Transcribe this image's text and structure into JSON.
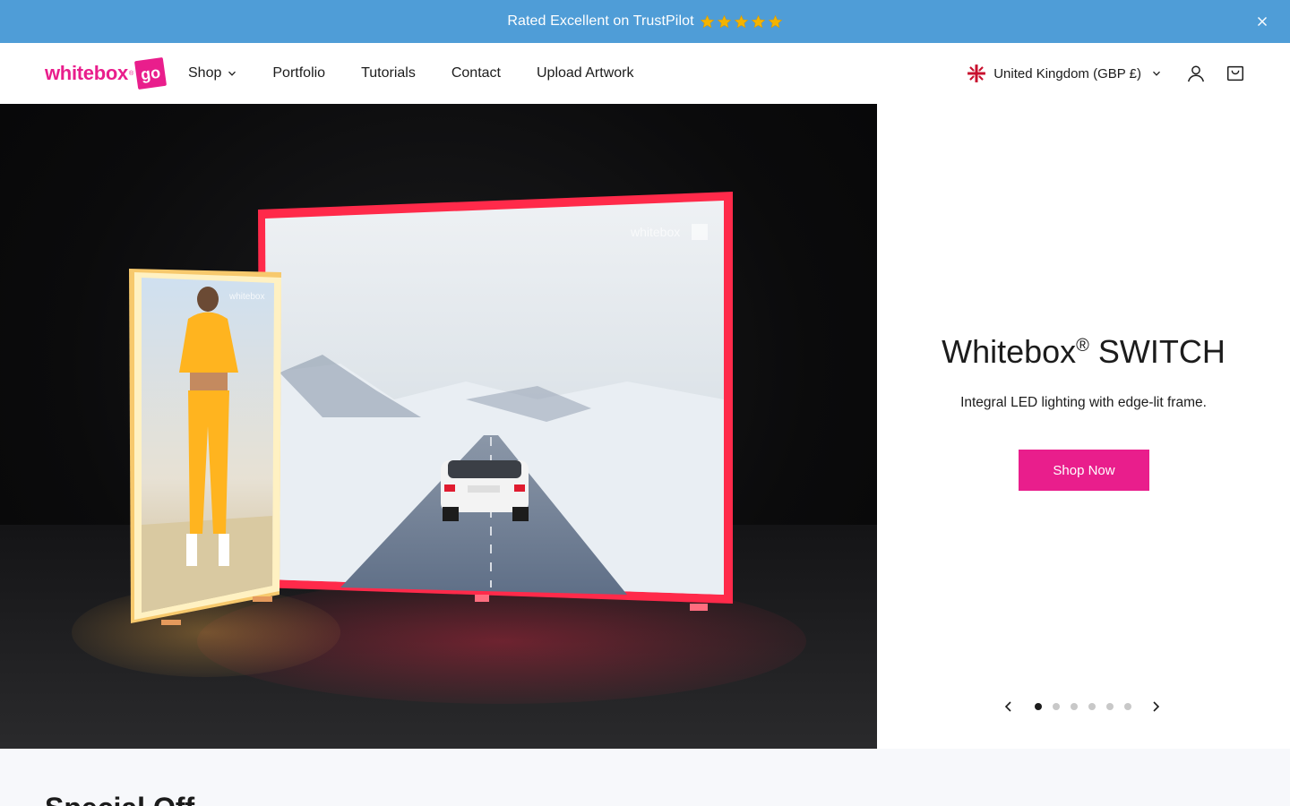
{
  "announcement": {
    "text": "Rated Excellent on TrustPilot",
    "stars": 5
  },
  "header": {
    "logo_text": "whitebox",
    "logo_reg": "®",
    "logo_go": "go",
    "nav": [
      {
        "label": "Shop"
      },
      {
        "label": "Portfolio"
      },
      {
        "label": "Tutorials"
      },
      {
        "label": "Contact"
      },
      {
        "label": "Upload Artwork"
      }
    ],
    "locale_label": "United Kingdom (GBP £)"
  },
  "hero": {
    "title": "Whitebox",
    "title_reg": "®",
    "title_suffix": " SWITCH",
    "subtitle": "Integral LED lighting with edge-lit frame.",
    "cta_label": "Shop Now",
    "slides_total": 6,
    "slide_active": 1,
    "image_watermark": "whitebox"
  },
  "offers": {
    "title": "Special Off"
  },
  "colors": {
    "announce_bg": "#4f9dd7",
    "brand_pink": "#e91e8c",
    "star": "#f4b400",
    "section_bg": "#f7f8fb"
  }
}
